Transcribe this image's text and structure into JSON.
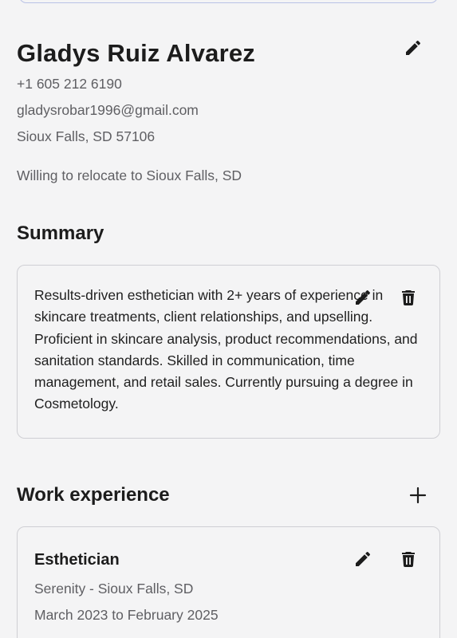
{
  "profile": {
    "name": "Gladys Ruiz Alvarez",
    "phone": "+1 605 212 6190",
    "email": "gladysrobar1996@gmail.com",
    "location": "Sioux Falls, SD 57106",
    "relocation": "Willing to relocate to Sioux Falls, SD"
  },
  "summary": {
    "title": "Summary",
    "text": "Results-driven esthetician with 2+ years of experience in skincare treatments, client relationships, and upselling. Proficient in skincare analysis, product recommendations, and sanitation standards. Skilled in communication, time management, and retail sales. Currently pursuing a degree in Cosmetology."
  },
  "work_experience": {
    "title": "Work experience",
    "items": [
      {
        "title": "Esthetician",
        "company_location": "Serenity - Sioux Falls, SD",
        "dates": "March 2023 to February 2025"
      }
    ]
  },
  "icons": {
    "edit": "pencil-icon",
    "delete": "trash-icon",
    "add": "plus-icon"
  },
  "colors": {
    "background": "#f4f4f5",
    "text_primary": "#1c1c1c",
    "text_secondary": "#5f5f63",
    "card_border": "#cfcfd4"
  }
}
